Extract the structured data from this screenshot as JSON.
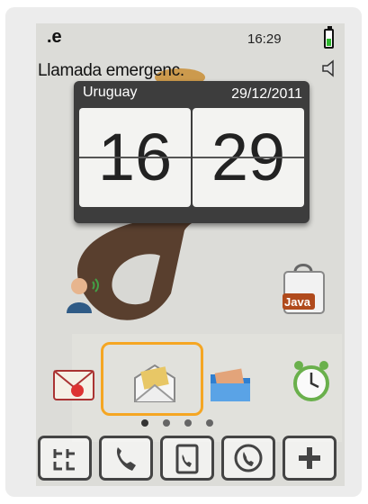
{
  "status": {
    "indicator": ".e",
    "time": "16:29",
    "battery_level": 0.45,
    "battery_color": "#2eb82e"
  },
  "carrier_text": "Llamada emergenc.",
  "clock_widget": {
    "city": "Uruguay",
    "date": "29/12/2011",
    "hours": "16",
    "minutes": "29"
  },
  "apps": {
    "contacts_icon": "contacts-icon",
    "java": {
      "label": "Java",
      "icon": "java-shopping-bag-icon"
    }
  },
  "dock": [
    "messages-icon",
    "email-icon",
    "files-icon",
    "alarm-clock-icon"
  ],
  "highlight_color": "#f5a623",
  "pager": {
    "pages": 4
  },
  "tabbar": [
    "keypad-icon",
    "call-log-icon",
    "contacts-book-icon",
    "voicemail-icon",
    "add-icon"
  ]
}
